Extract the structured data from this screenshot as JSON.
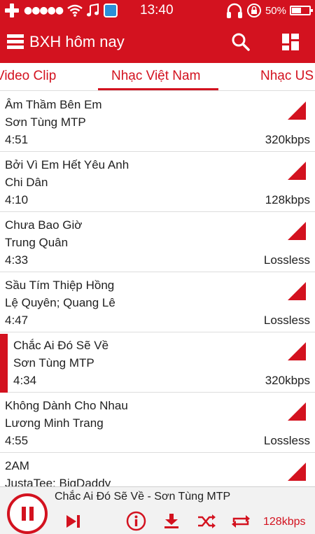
{
  "status_bar": {
    "signal": "●●●●●",
    "time": "13:40",
    "battery": "50%",
    "icons": [
      "add-icon",
      "signal-icon",
      "wifi-icon",
      "music-icon",
      "app-icon",
      "headphones-icon",
      "lock-rotation-icon",
      "battery-icon"
    ]
  },
  "app_bar": {
    "title": "BXH hôm nay",
    "icons": [
      "list-menu-icon",
      "search-icon",
      "grid-icon"
    ]
  },
  "tabs": [
    {
      "label": "Video Clip"
    },
    {
      "label": "Nhạc Việt Nam"
    },
    {
      "label": "Nhạc US"
    }
  ],
  "songs": [
    {
      "title": "Âm Thầm Bên Em",
      "artist": "Sơn Tùng MTP",
      "duration": "4:51",
      "quality": "320kbps"
    },
    {
      "title": "Bởi Vì Em Hết Yêu Anh",
      "artist": "Chi Dân",
      "duration": "4:10",
      "quality": "128kbps"
    },
    {
      "title": "Chưa Bao Giờ",
      "artist": "Trung Quân",
      "duration": "4:33",
      "quality": "Lossless"
    },
    {
      "title": "Sầu Tím Thiệp Hồng",
      "artist": "Lệ Quyên; Quang Lê",
      "duration": "4:47",
      "quality": "Lossless"
    },
    {
      "title": "Chắc Ai Đó Sẽ Về",
      "artist": "Sơn Tùng MTP",
      "duration": "4:34",
      "quality": "320kbps"
    },
    {
      "title": "Không Dành Cho Nhau",
      "artist": "Lương Minh Trang",
      "duration": "4:55",
      "quality": "Lossless"
    },
    {
      "title": "2AM",
      "artist": "JustaTee; BigDaddy",
      "duration": "",
      "quality": ""
    }
  ],
  "player": {
    "now_playing": "Chắc Ai Đó Sẽ Về - Sơn Tùng MTP",
    "bitrate": "128kbps"
  },
  "colors": {
    "accent": "#d3121f",
    "text": "#1f1f1f",
    "divider": "#dddddd"
  }
}
